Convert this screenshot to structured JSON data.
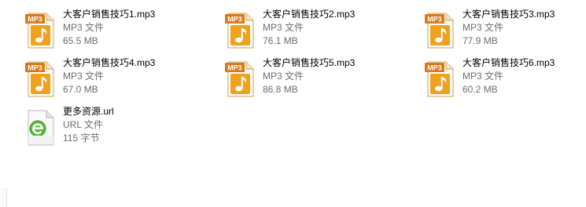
{
  "files": [
    {
      "name": "大客户销售技巧1.mp3",
      "type": "MP3 文件",
      "size": "65.5 MB",
      "icon": "mp3-icon"
    },
    {
      "name": "大客户销售技巧2.mp3",
      "type": "MP3 文件",
      "size": "76.1 MB",
      "icon": "mp3-icon"
    },
    {
      "name": "大客户销售技巧3.mp3",
      "type": "MP3 文件",
      "size": "77.9 MB",
      "icon": "mp3-icon"
    },
    {
      "name": "大客户销售技巧4.mp3",
      "type": "MP3 文件",
      "size": "67.0 MB",
      "icon": "mp3-icon"
    },
    {
      "name": "大客户销售技巧5.mp3",
      "type": "MP3 文件",
      "size": "86.8 MB",
      "icon": "mp3-icon"
    },
    {
      "name": "大客户销售技巧6.mp3",
      "type": "MP3 文件",
      "size": "60.2 MB",
      "icon": "mp3-icon"
    },
    {
      "name": "更多资源.url",
      "type": "URL 文件",
      "size": "115 字节",
      "icon": "url-shortcut-icon"
    }
  ],
  "icon_badge_text": "MP3",
  "colors": {
    "mp3_orange": "#f0a21e",
    "mp3_badge": "#d8791a",
    "url_green": "#5cb93c"
  }
}
